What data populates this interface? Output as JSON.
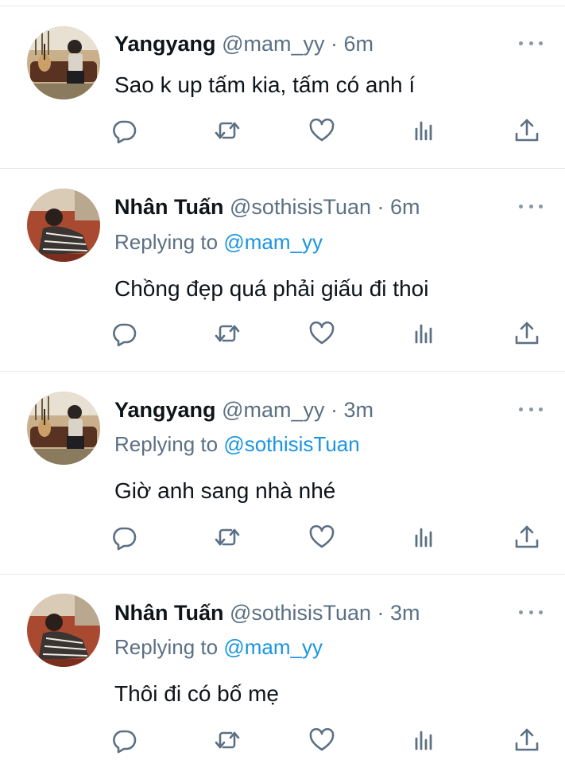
{
  "tweets": [
    {
      "name": "Yangyang",
      "handle": "@mam_yy",
      "time": "6m",
      "separator": "·",
      "replying_prefix": "",
      "replying_to": "",
      "text": "Sao k up tấm kia, tấm có anh í",
      "avatar": "yangyang-avatar"
    },
    {
      "name": "Nhân Tuấn",
      "handle": "@sothisisTuan",
      "time": "6m",
      "separator": "·",
      "replying_prefix": "Replying to",
      "replying_to": "@mam_yy",
      "text": "Chồng đẹp quá phải giấu đi thoi",
      "avatar": "nhan-tuan-avatar"
    },
    {
      "name": "Yangyang",
      "handle": "@mam_yy",
      "time": "3m",
      "separator": "·",
      "replying_prefix": "Replying to",
      "replying_to": "@sothisisTuan",
      "text": "Giờ anh sang nhà nhé",
      "avatar": "yangyang-avatar"
    },
    {
      "name": "Nhân Tuấn",
      "handle": "@sothisisTuan",
      "time": "3m",
      "separator": "·",
      "replying_prefix": "Replying to",
      "replying_to": "@mam_yy",
      "text": "Thôi đi có bố mẹ",
      "avatar": "nhan-tuan-avatar"
    }
  ],
  "action_icons": [
    "reply-icon",
    "retweet-icon",
    "like-icon",
    "analytics-icon",
    "share-icon"
  ],
  "colors": {
    "text": "#0f1419",
    "secondary": "#5b7083",
    "mention": "#1b95e0",
    "divider": "#e3e6e8",
    "icon": "#5b7083"
  }
}
